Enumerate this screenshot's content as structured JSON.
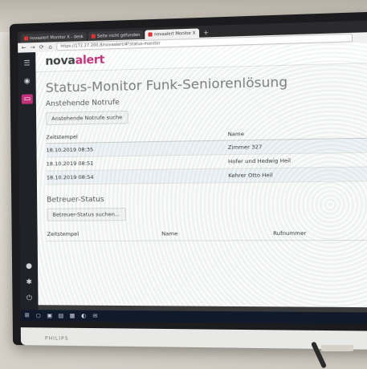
{
  "browser": {
    "tabs": [
      {
        "label": "novaalert Monitor X - desk"
      },
      {
        "label": "Seite nicht gefunden"
      },
      {
        "label": "novaalert Monitor X",
        "active": true
      }
    ],
    "url": "https://172.27.200.8/novaalert/#!status-monitor"
  },
  "app": {
    "logo_main": "nova",
    "logo_accent": "alert",
    "page_title": "Status-Monitor Funk-Seniorenlösung",
    "notrufe": {
      "section_title": "Anstehende Notrufe",
      "search_button": "Anstehende Notrufe suche",
      "columns": [
        "Zeitstempel",
        "Name"
      ],
      "rows": [
        [
          "18.10.2019 08:35",
          "Zimmer 327"
        ],
        [
          "18.10.2019 08:51",
          "Hofer und Hedwig Heil"
        ],
        [
          "18.10.2019 08:54",
          "Kehrer Otto Heil"
        ]
      ]
    },
    "betreuer": {
      "section_title": "Betreuer-Status",
      "search_button": "Betreuer-Status suchen...",
      "columns": [
        "Zeitstempel",
        "Name",
        "Rufnummer"
      ]
    }
  },
  "monitor": {
    "brand": "PHILIPS"
  },
  "colors": {
    "accent": "#c2327a",
    "sidebar": "#1f2227"
  }
}
